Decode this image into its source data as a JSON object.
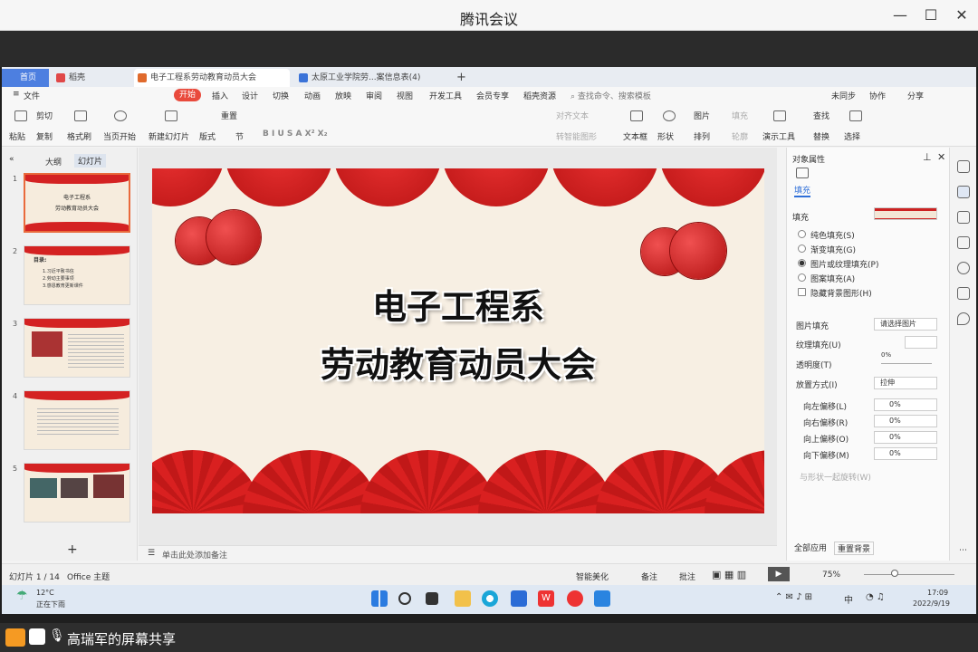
{
  "meeting": {
    "title": "腾讯会议",
    "min": "—",
    "max": "☐",
    "close": "✕",
    "share_text": "高瑞军的屏幕共享"
  },
  "wps": {
    "tabs": [
      "首页",
      "稻壳",
      "电子工程系劳动教育动员大会",
      "太原工业学院劳...案信息表(4)"
    ],
    "tab_add": "+",
    "menus": [
      "文件",
      "开始",
      "插入",
      "设计",
      "切换",
      "动画",
      "放映",
      "审阅",
      "视图",
      "开发工具",
      "会员专享",
      "稻壳资源"
    ],
    "search": "查找命令、搜索模板",
    "right_menus": [
      "未同步",
      "协作",
      "分享"
    ],
    "ribbon_top": [
      "剪切",
      "重置"
    ],
    "ribbon_bottom": [
      "粘贴",
      "复制",
      "格式刷",
      "当页开始",
      "新建幻灯片",
      "版式",
      "节",
      "文本框",
      "形状",
      "排列",
      "演示工具",
      "替换",
      "选择"
    ],
    "ribbon_right_top": [
      "图片",
      "查找"
    ],
    "ribbon_mid": [
      "对齐文本",
      "转智能图形",
      "轮廓",
      "填充"
    ],
    "left_tabs": [
      "大纲",
      "幻灯片"
    ],
    "thumbs": [
      "1",
      "2",
      "3",
      "4",
      "5"
    ],
    "thumb1_lines": [
      "电子工程系",
      "劳动教育动员大会"
    ],
    "thumb2_lines": [
      "目录:",
      "1.习近平致书信",
      "2.劳动主要事项",
      "3.感恩教育更新课件"
    ],
    "slide_title1": "电子工程系",
    "slide_title2": "劳动教育动员大会",
    "notes": "单击此处添加备注",
    "panel": {
      "title": "对象属性",
      "tab": "填充",
      "section": "填充",
      "options": [
        "纯色填充(S)",
        "渐变填充(G)",
        "图片或纹理填充(P)",
        "图案填充(A)",
        "隐藏背景图形(H)"
      ],
      "picture_fill_label": "图片填充",
      "picture_fill_value": "请选择图片",
      "texture_label": "纹理填充(U)",
      "transparency_label": "透明度(T)",
      "transparency_value": "0%",
      "placement_label": "放置方式(I)",
      "placement_value": "拉伸",
      "offsets": [
        {
          "label": "向左偏移(L)",
          "value": "0%"
        },
        {
          "label": "向右偏移(R)",
          "value": "0%"
        },
        {
          "label": "向上偏移(O)",
          "value": "0%"
        },
        {
          "label": "向下偏移(M)",
          "value": "0%"
        }
      ],
      "rotate_label": "与形状一起旋转(W)",
      "apply_all": "全部应用",
      "reset_bg": "重置背景"
    },
    "status": {
      "slide": "幻灯片 1 / 14",
      "theme": "Office 主题",
      "beautify": "智能美化",
      "notes": "备注",
      "comment": "批注",
      "zoom": "75%"
    }
  },
  "taskbar": {
    "weather_temp": "12°C",
    "weather_text": "正在下雨",
    "time": "17:09",
    "date": "2022/9/19",
    "lang": "中"
  }
}
